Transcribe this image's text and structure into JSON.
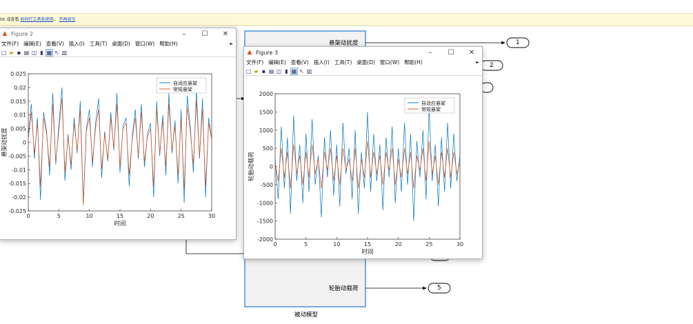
{
  "banner": {
    "prefix": "bb",
    "text": "或查看",
    "link1": "如何打工具条使用",
    "sep": "，",
    "link2": "不再显示"
  },
  "menu_items": [
    "文件(F)",
    "编辑(E)",
    "查看(V)",
    "插入(I)",
    "工具(T)",
    "桌面(D)",
    "窗口(W)",
    "帮助(H)"
  ],
  "simulink": {
    "blocks": {
      "out1": "悬架动扰度",
      "out5": "轮胎动载荷",
      "subsystem_name": "被动模型"
    },
    "ports": [
      "1",
      "2",
      "5"
    ]
  },
  "figure2": {
    "title": "Figure 2",
    "legend": [
      "自适应悬架",
      "常规悬架"
    ],
    "ylabel": "悬架动扰度",
    "xlabel": "时间",
    "xticks": [
      "0",
      "5",
      "10",
      "15",
      "20",
      "25",
      "30"
    ],
    "yticks": [
      "-0.025",
      "-0.02",
      "-0.015",
      "-0.01",
      "-0.005",
      "0",
      "0.005",
      "0.01",
      "0.015",
      "0.02",
      "0.025"
    ]
  },
  "figure3": {
    "title": "Figure 3",
    "legend": [
      "自适应悬架",
      "常规悬架"
    ],
    "ylabel": "轮胎动载荷",
    "xlabel": "时间",
    "xticks": [
      "0",
      "5",
      "10",
      "15",
      "20",
      "25",
      "30"
    ],
    "yticks": [
      "-2000",
      "-1500",
      "-1000",
      "-500",
      "0",
      "500",
      "1000",
      "1500",
      "2000"
    ]
  },
  "chart_data": [
    {
      "type": "line",
      "xlabel": "时间",
      "ylabel": "悬架动扰度",
      "xlim": [
        0,
        30
      ],
      "ylim": [
        -0.025,
        0.025
      ],
      "legend_placement": "top-right",
      "colors": [
        "#0072bd",
        "#d95319"
      ],
      "x": [
        0,
        0.5,
        1,
        1.5,
        2,
        2.5,
        3,
        3.5,
        4,
        4.5,
        5,
        5.5,
        6,
        6.5,
        7,
        7.5,
        8,
        8.5,
        9,
        9.5,
        10,
        10.5,
        11,
        11.5,
        12,
        12.5,
        13,
        13.5,
        14,
        14.5,
        15,
        15.5,
        16,
        16.5,
        17,
        17.5,
        18,
        18.5,
        19,
        19.5,
        20,
        20.5,
        21,
        21.5,
        22,
        22.5,
        23,
        23.5,
        24,
        24.5,
        25,
        25.5,
        26,
        26.5,
        27,
        27.5,
        28,
        28.5,
        29,
        29.5,
        30
      ],
      "series": [
        {
          "name": "自适应悬架",
          "values": [
            0.002,
            0.014,
            -0.006,
            0.009,
            -0.021,
            0.011,
            0.004,
            -0.012,
            0.018,
            -0.008,
            0.006,
            0.02,
            -0.014,
            0.003,
            -0.01,
            0.009,
            -0.004,
            0.015,
            -0.022,
            0.005,
            0.012,
            -0.009,
            0.007,
            0.016,
            -0.013,
            0.004,
            -0.007,
            0.011,
            -0.003,
            0.018,
            -0.011,
            0.006,
            0.009,
            -0.016,
            0.002,
            0.012,
            -0.006,
            0.014,
            -0.009,
            0.003,
            0.007,
            -0.02,
            0.015,
            -0.005,
            0.01,
            -0.012,
            0.018,
            -0.004,
            0.008,
            -0.015,
            0.012,
            -0.022,
            0.017,
            0.006,
            -0.011,
            0.019,
            -0.006,
            0.016,
            -0.02,
            0.009,
            0.001
          ]
        },
        {
          "name": "常规悬架",
          "values": [
            0.001,
            0.011,
            -0.004,
            0.007,
            -0.016,
            0.009,
            0.003,
            -0.009,
            0.014,
            -0.007,
            0.004,
            0.016,
            -0.011,
            0.002,
            -0.008,
            0.007,
            -0.003,
            0.012,
            -0.023,
            0.004,
            0.009,
            -0.007,
            0.005,
            0.012,
            -0.01,
            0.003,
            -0.006,
            0.009,
            -0.002,
            0.014,
            -0.009,
            0.005,
            0.007,
            -0.012,
            0.001,
            0.009,
            -0.005,
            0.011,
            -0.007,
            0.002,
            0.005,
            -0.016,
            0.012,
            -0.004,
            0.008,
            -0.009,
            0.014,
            -0.003,
            0.006,
            -0.012,
            0.009,
            -0.017,
            0.013,
            0.004,
            -0.008,
            0.015,
            -0.005,
            0.012,
            -0.016,
            0.007,
            0.001
          ]
        }
      ]
    },
    {
      "type": "line",
      "xlabel": "时间",
      "ylabel": "轮胎动载荷",
      "xlim": [
        0,
        30
      ],
      "ylim": [
        -2000,
        2000
      ],
      "legend_placement": "top-right",
      "colors": [
        "#0072bd",
        "#d95319"
      ],
      "x": [
        0,
        0.5,
        1,
        1.5,
        2,
        2.5,
        3,
        3.5,
        4,
        4.5,
        5,
        5.5,
        6,
        6.5,
        7,
        7.5,
        8,
        8.5,
        9,
        9.5,
        10,
        10.5,
        11,
        11.5,
        12,
        12.5,
        13,
        13.5,
        14,
        14.5,
        15,
        15.5,
        16,
        16.5,
        17,
        17.5,
        18,
        18.5,
        19,
        19.5,
        20,
        20.5,
        21,
        21.5,
        22,
        22.5,
        23,
        23.5,
        24,
        24.5,
        25,
        25.5,
        26,
        26.5,
        27,
        27.5,
        28,
        28.5,
        29,
        29.5,
        30
      ],
      "series": [
        {
          "name": "自适应悬架",
          "values": [
            200,
            -900,
            1100,
            -600,
            800,
            -1300,
            1400,
            -400,
            600,
            -1000,
            900,
            -700,
            1300,
            -500,
            300,
            -1400,
            800,
            -300,
            1000,
            -800,
            600,
            -1100,
            1200,
            -200,
            500,
            -900,
            1000,
            -1300,
            400,
            -600,
            1500,
            -700,
            900,
            -400,
            600,
            -1200,
            800,
            -300,
            1100,
            -1000,
            500,
            -700,
            1200,
            -500,
            900,
            -1500,
            700,
            -300,
            1000,
            -900,
            1600,
            -400,
            600,
            -1100,
            800,
            -700,
            1200,
            -600,
            900,
            -400,
            300
          ]
        },
        {
          "name": "常规悬架",
          "values": [
            100,
            -400,
            500,
            -300,
            400,
            -600,
            600,
            -200,
            300,
            -500,
            400,
            -300,
            600,
            -200,
            200,
            -600,
            400,
            -100,
            500,
            -400,
            300,
            -500,
            500,
            -100,
            200,
            -400,
            500,
            -600,
            200,
            -300,
            700,
            -300,
            400,
            -200,
            300,
            -500,
            400,
            -100,
            500,
            -500,
            200,
            -300,
            500,
            -200,
            400,
            -600,
            300,
            -100,
            500,
            -400,
            700,
            -200,
            300,
            -500,
            400,
            -300,
            500,
            -300,
            400,
            -200,
            100
          ]
        }
      ]
    }
  ]
}
